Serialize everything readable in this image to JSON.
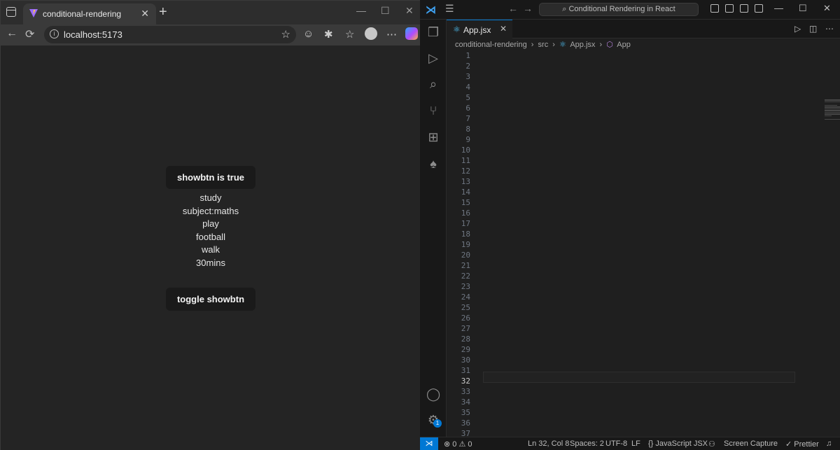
{
  "browser": {
    "tab_title": "conditional-rendering",
    "tab_close": "✕",
    "new_tab": "+",
    "url": "localhost:5173",
    "page": {
      "top_button": "showbtn is true",
      "todos": [
        "study",
        "subject:maths",
        "play",
        "football",
        "walk",
        "30mins"
      ],
      "toggle_button": "toggle showbtn"
    }
  },
  "vscode": {
    "command_center": "Conditional Rendering in React",
    "tab_name": "App.jsx",
    "breadcrumb": [
      "conditional-rendering",
      "›",
      "src",
      "›",
      "App.jsx",
      "›",
      "App"
    ],
    "active_line": 32,
    "status": {
      "problems": "⊗ 0 ⚠ 0",
      "position": "Ln 32, Col 8",
      "spaces": "Spaces: 2",
      "encoding": "UTF-8",
      "eol": "LF",
      "language": "{} JavaScript JSX",
      "capture": "Screen Capture",
      "prettier": "✓ Prettier"
    },
    "account_badge": "1",
    "line_numbers": [
      "1",
      "2",
      "3",
      "4",
      "5",
      "6",
      "7",
      "8",
      "9",
      "10",
      "11",
      "12",
      "13",
      "14",
      "15",
      "16",
      "17",
      "18",
      "19",
      "20",
      "21",
      "22",
      "23",
      "24",
      "25",
      "26",
      "27",
      "28",
      "29",
      "30",
      "31",
      "32",
      "33",
      "34",
      "35",
      "36",
      "37"
    ]
  },
  "colors": {
    "accent": "#0078d4",
    "editor_bg": "#1f1f1f",
    "browser_bg": "#242424",
    "button_bg": "#1a1a1a"
  },
  "icons": [
    "window-icon",
    "vite-favicon",
    "back-icon",
    "reload-icon",
    "info-icon",
    "star-icon",
    "extensions-icon",
    "favorites-icon",
    "copilot-icon",
    "vscode-logo-icon",
    "explorer-icon",
    "run-debug-icon",
    "search-icon",
    "source-control-icon",
    "extensions-icon",
    "mongodb-leaf-icon",
    "account-icon",
    "gear-icon",
    "react-icon",
    "run-icon",
    "split-editor-icon"
  ]
}
